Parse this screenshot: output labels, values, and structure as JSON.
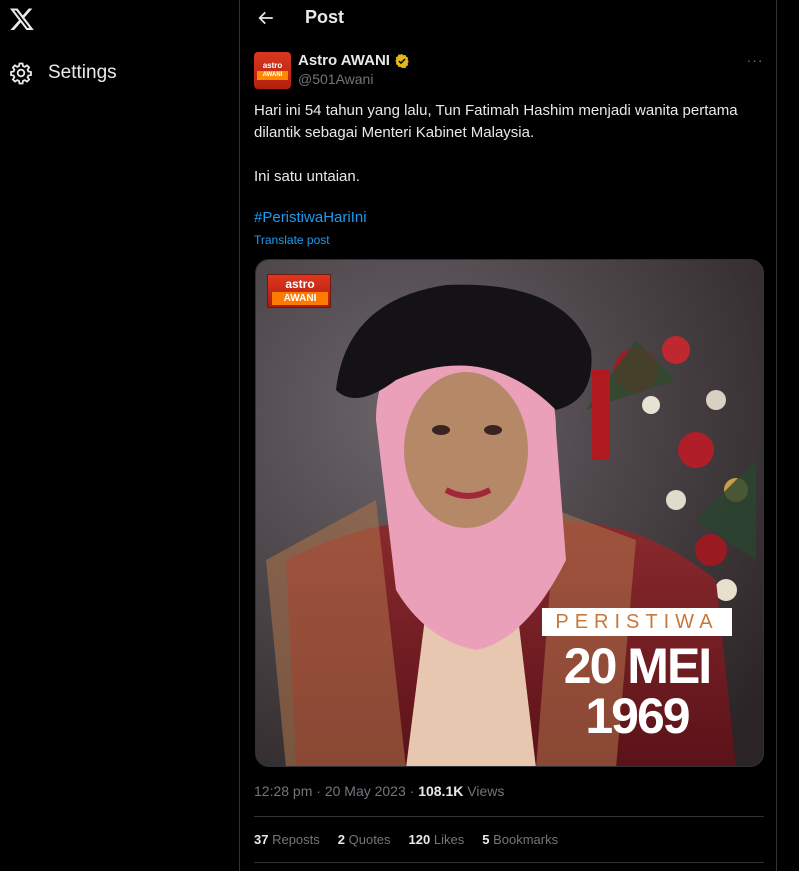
{
  "nav": {
    "logo_icon": "x-logo-icon",
    "settings_label": "Settings",
    "settings_icon": "gear-icon"
  },
  "header": {
    "back_icon": "back-arrow-icon",
    "title": "Post"
  },
  "post": {
    "author_name": "Astro AWANI",
    "author_handle": "@501Awani",
    "avatar_text_top": "astro",
    "avatar_text_bottom": "AWANI",
    "verified_color": "#e2b719",
    "more_label": "···",
    "text_line1": "Hari ini 54 tahun yang lalu, Tun Fatimah Hashim menjadi wanita pertama dilantik sebagai Menteri Kabinet Malaysia.",
    "text_line2": "Ini satu untaian.",
    "hashtag": "#PeristiwaHariIni",
    "translate": "Translate post",
    "media": {
      "logo_top": "astro",
      "logo_bottom": "AWANI",
      "banner": "PERISTIWA",
      "date_line1": "20 MEI",
      "date_line2": "1969"
    },
    "time": "12:28 pm · 20 May 2023 · ",
    "views_count": "108.1K",
    "views_label": " Views",
    "stats": {
      "reposts_count": "37",
      "reposts_label": " Reposts",
      "quotes_count": "2",
      "quotes_label": " Quotes",
      "likes_count": "120",
      "likes_label": " Likes",
      "bookmarks_count": "5",
      "bookmarks_label": " Bookmarks"
    }
  },
  "colors": {
    "link": "#1d9bf0",
    "muted": "#71767b",
    "text": "#e7e9ea",
    "border": "#2f3336"
  }
}
